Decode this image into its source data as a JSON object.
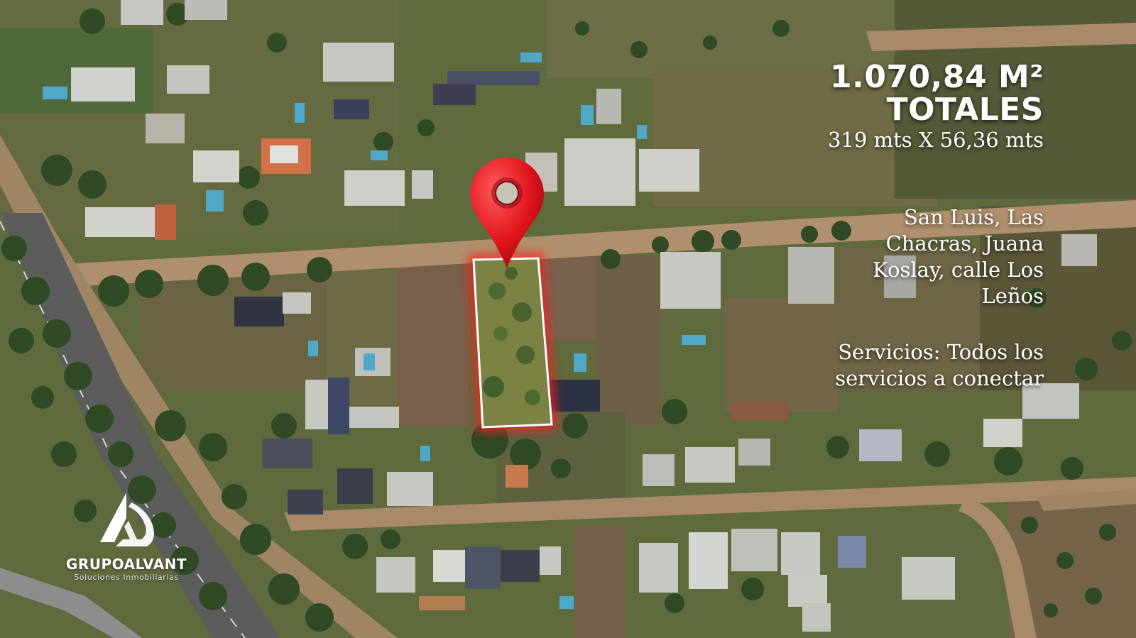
{
  "listing": {
    "area_value": "1.070,84 M²",
    "area_caption": "TOTALES",
    "dimensions": "319 mts X 56,36 mts",
    "location": "San Luis, Las Chacras, Juana Koslay, calle Los Leños",
    "services": "Servicios: Todos los servicios a conectar"
  },
  "brand": {
    "name": "GRUPOALVANT",
    "tagline": "Soluciones Inmobiliarias"
  },
  "icons": {
    "pin": "map-pin-icon",
    "logo": "alvant-logo-icon"
  },
  "colors": {
    "pin": "#e0131b",
    "lot_outline": "#ffffff",
    "lot_glow": "#ff1a1a",
    "road": "#b0906c",
    "highway": "#5c5c5c"
  }
}
